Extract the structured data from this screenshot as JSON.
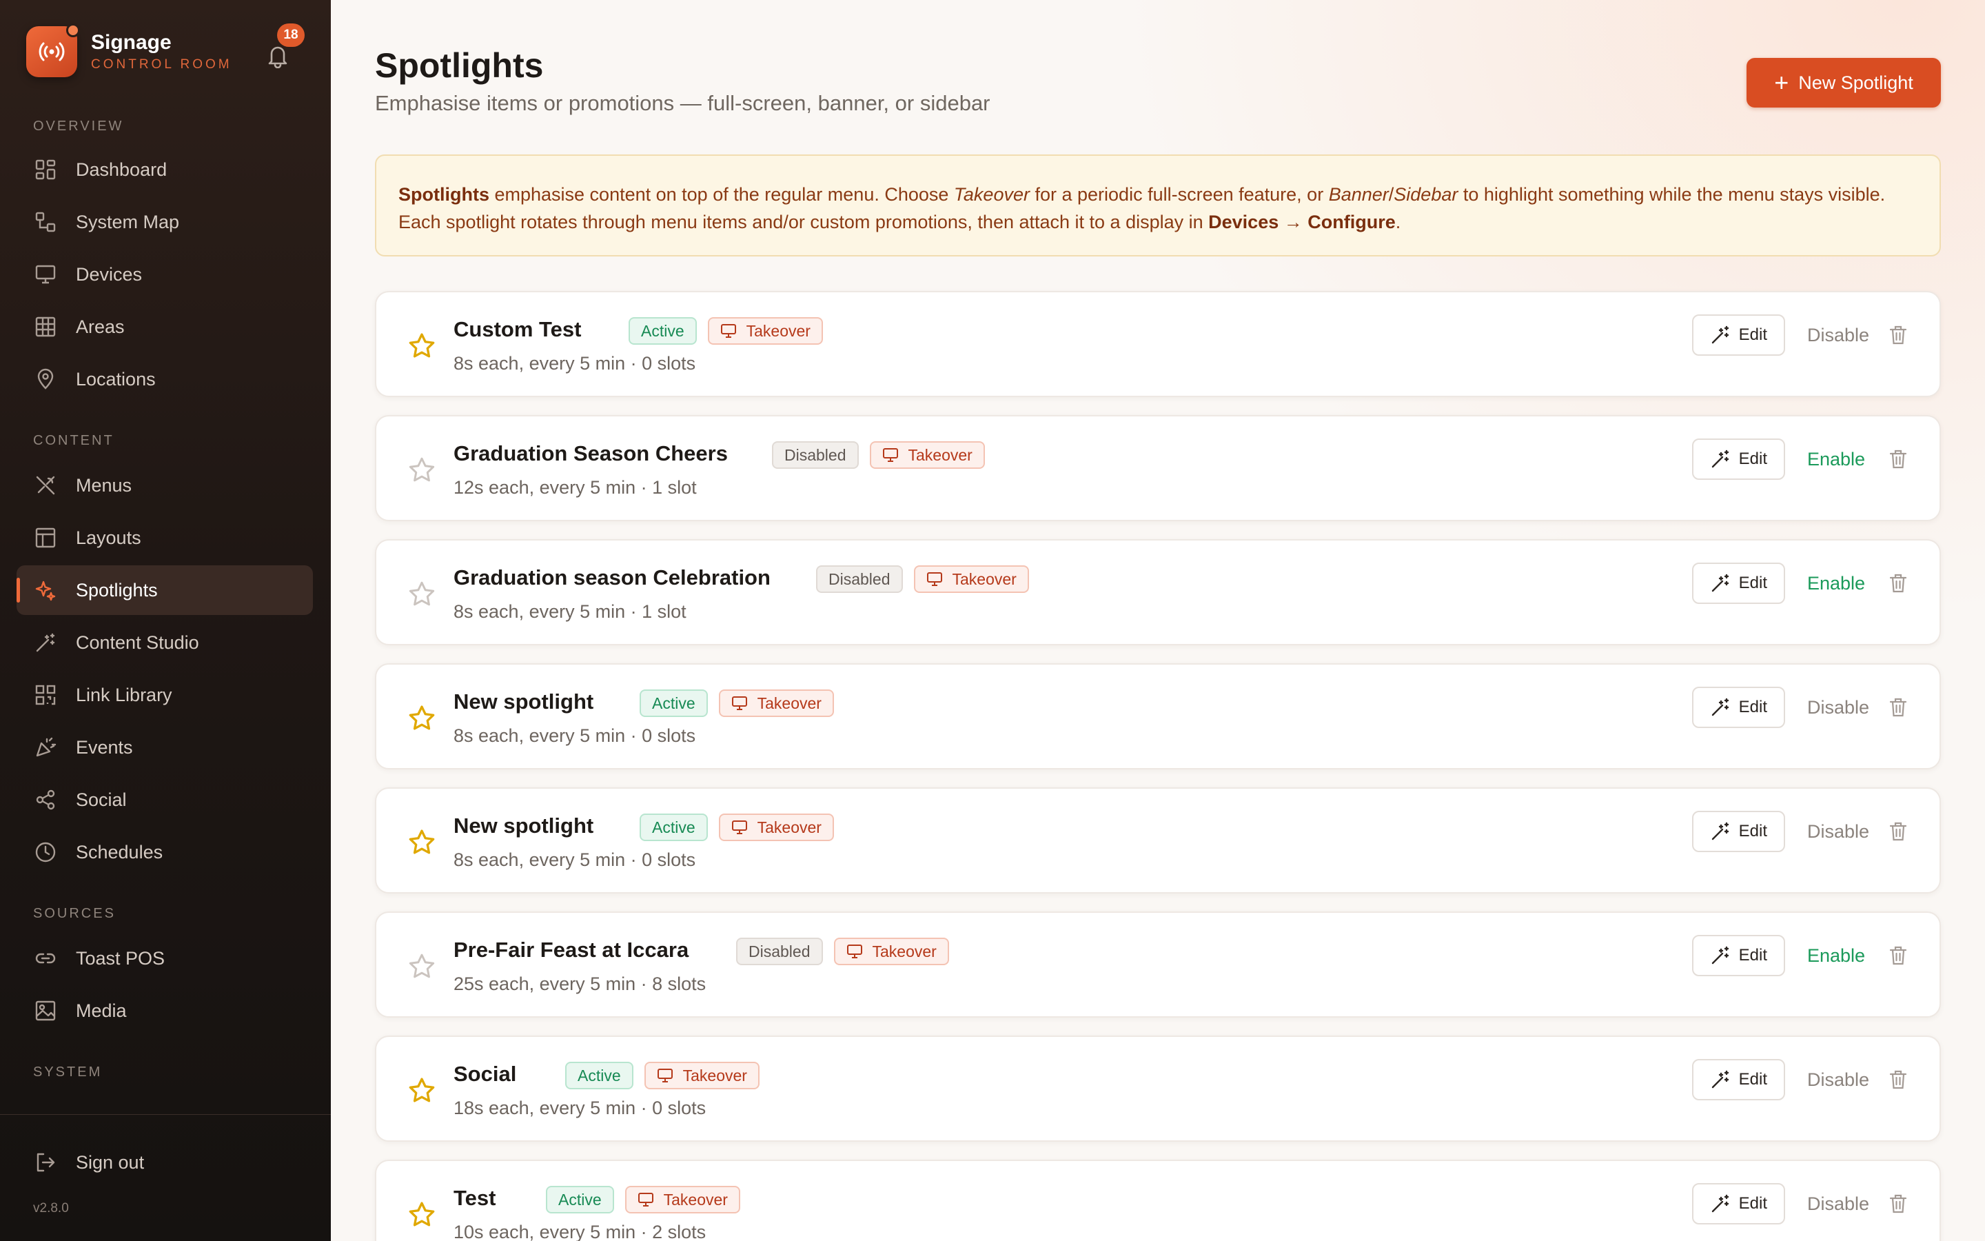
{
  "brand": {
    "name": "Signage",
    "subtitle": "CONTROL ROOM",
    "notification_count": "18"
  },
  "sidebar": {
    "sections": {
      "overview": "OVERVIEW",
      "content": "CONTENT",
      "sources": "SOURCES",
      "system": "SYSTEM"
    },
    "items": {
      "dashboard": "Dashboard",
      "system_map": "System Map",
      "devices": "Devices",
      "areas": "Areas",
      "locations": "Locations",
      "menus": "Menus",
      "layouts": "Layouts",
      "spotlights": "Spotlights",
      "content_studio": "Content Studio",
      "link_library": "Link Library",
      "events": "Events",
      "social": "Social",
      "schedules": "Schedules",
      "toast_pos": "Toast POS",
      "media": "Media"
    },
    "active_item": "spotlights",
    "sign_out": "Sign out",
    "version": "v2.8.0"
  },
  "header": {
    "title": "Spotlights",
    "subtitle": "Emphasise items or promotions — full-screen, banner, or sidebar",
    "new_button": "New Spotlight"
  },
  "info": {
    "t1": "Spotlights",
    "t2": " emphasise content on top of the regular menu. Choose ",
    "t3": "Takeover",
    "t4": " for a periodic full-screen feature, or ",
    "t5": "Banner",
    "t6": "/",
    "t7": "Sidebar",
    "t8": " to highlight something while the menu stays visible. Each spotlight rotates through menu items and/or custom promotions, then attach it to a display in ",
    "t9": "Devices",
    "t10": " → ",
    "t11": "Configure",
    "t12": "."
  },
  "labels": {
    "edit": "Edit",
    "takeover": "Takeover"
  },
  "spotlights": [
    {
      "name": "Custom Test",
      "meta": "8s each, every 5 min · 0 slots",
      "status": "Active",
      "action": "Disable"
    },
    {
      "name": "Graduation Season Cheers",
      "meta": "12s each, every 5 min · 1 slot",
      "status": "Disabled",
      "action": "Enable"
    },
    {
      "name": "Graduation season Celebration",
      "meta": "8s each, every 5 min · 1 slot",
      "status": "Disabled",
      "action": "Enable"
    },
    {
      "name": "New spotlight",
      "meta": "8s each, every 5 min · 0 slots",
      "status": "Active",
      "action": "Disable"
    },
    {
      "name": "New spotlight",
      "meta": "8s each, every 5 min · 0 slots",
      "status": "Active",
      "action": "Disable"
    },
    {
      "name": "Pre-Fair Feast at Iccara",
      "meta": "25s each, every 5 min · 8 slots",
      "status": "Disabled",
      "action": "Enable"
    },
    {
      "name": "Social",
      "meta": "18s each, every 5 min · 0 slots",
      "status": "Active",
      "action": "Disable"
    },
    {
      "name": "Test",
      "meta": "10s each, every 5 min · 2 slots",
      "status": "Active",
      "action": "Disable"
    }
  ],
  "colors": {
    "accent": "#d94d22",
    "sidebar_bg": "#1f1714",
    "active_green": "#178a54",
    "enable_green": "#1b9a5a",
    "star_gold": "#e0a800",
    "takeover_red": "#b5391a"
  }
}
